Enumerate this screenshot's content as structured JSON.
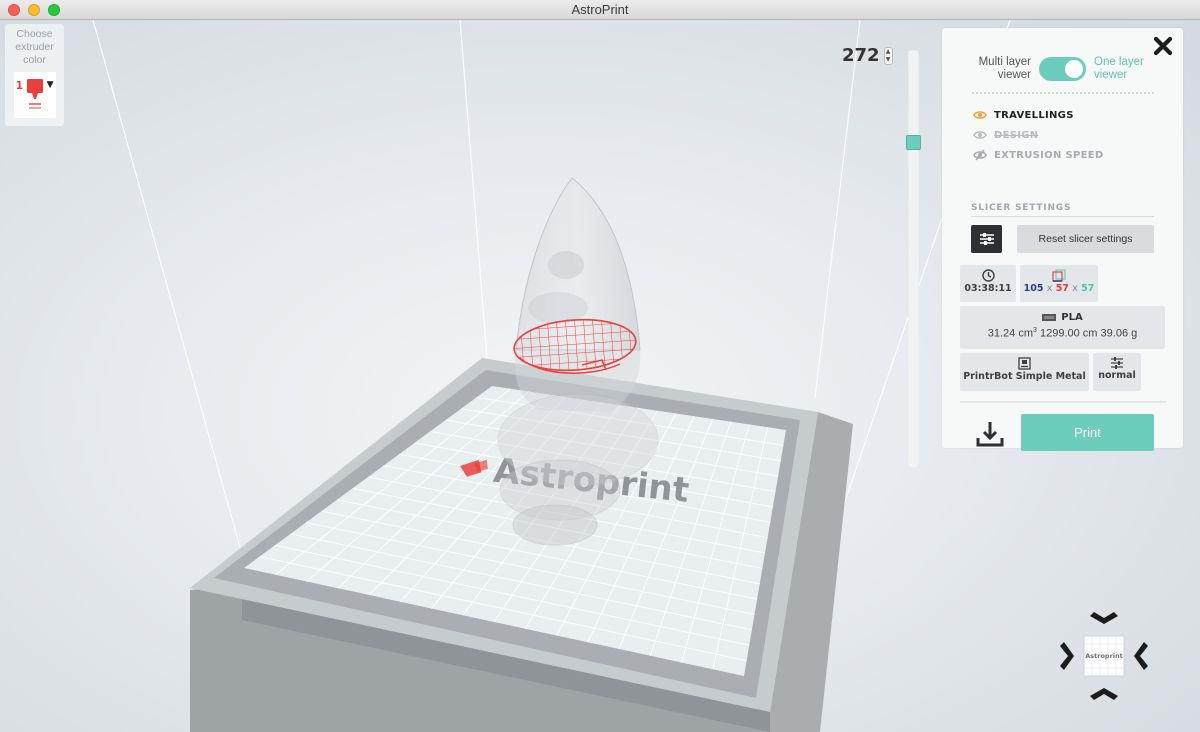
{
  "window": {
    "title": "AstroPrint"
  },
  "extruder": {
    "label_line1": "Choose",
    "label_line2": "extruder",
    "label_line3": "color",
    "number": "1",
    "color": "#e8413c"
  },
  "layer": {
    "current": "272",
    "position": 0.79
  },
  "viewer": {
    "multi_line1": "Multi layer",
    "multi_line2": "viewer",
    "one_line1": "One layer",
    "one_line2": "viewer",
    "one_layer_enabled": true
  },
  "visibility": [
    {
      "label": "TRAVELLINGS",
      "state": "on",
      "icon": "eye-icon"
    },
    {
      "label": "DESIGN",
      "state": "off",
      "icon": "eye-icon"
    },
    {
      "label": "EXTRUSION SPEED",
      "state": "dim",
      "icon": "eye-slash-icon"
    }
  ],
  "slicer": {
    "title": "SLICER SETTINGS",
    "reset_label": "Reset slicer settings"
  },
  "stats": {
    "time": "03:38:11",
    "dim_x": "105",
    "dim_y": "57",
    "dim_z": "57",
    "dim_sep": "x",
    "material": "PLA",
    "volume": "31.24 cm",
    "volume_exp": "3",
    "length": "1299.00 cm",
    "weight": "39.06 g"
  },
  "printer": {
    "name": "PrintrBot Simple Metal",
    "quality": "normal"
  },
  "actions": {
    "print_label": "Print"
  },
  "scene": {
    "bed_logo_text": "Astroprint",
    "mini_logo_text": "Astroprint",
    "accent": "#6ccdbd",
    "layer_color": "#e8413c"
  }
}
